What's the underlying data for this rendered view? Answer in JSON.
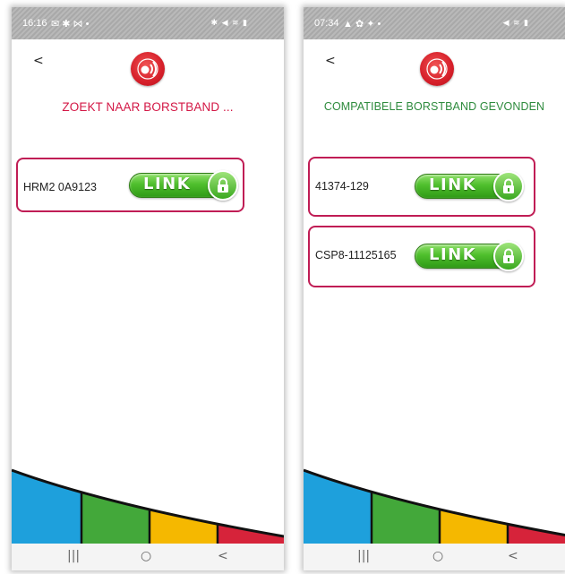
{
  "left_screen": {
    "status_time": "16:16",
    "status_left_icons": "✉ ✱ ⋈ •",
    "status_right_icons": "✱ ◀ ≋ ▮",
    "back_label": "<",
    "title": "ZOEKT NAAR BORSTBAND ...",
    "devices": [
      {
        "name": "HRM2 0A9123",
        "button_label": "LINK"
      }
    ],
    "nav": {
      "recents": "|||",
      "home": "○",
      "back": "<"
    }
  },
  "right_screen": {
    "status_time": "07:34",
    "status_left_icons": "▲ ✿ ✦ •",
    "status_right_icons": "◀ ≋ ▮",
    "back_label": "<",
    "title": "COMPATIBELE BORSTBAND GEVONDEN",
    "devices": [
      {
        "name": "41374-129",
        "button_label": "LINK"
      },
      {
        "name": "CSP8-11125165",
        "button_label": "LINK"
      }
    ],
    "nav": {
      "recents": "|||",
      "home": "○",
      "back": "<"
    }
  },
  "colors": {
    "title_searching": "#d31745",
    "title_found": "#2e8b3d",
    "card_border": "#c01d55",
    "link_green": "#4fbf2d",
    "wave_blue": "#1ea0dc",
    "wave_green": "#43a83a",
    "wave_yellow": "#f5b800",
    "wave_red": "#d6233a"
  },
  "icons": [
    "back-arrow-icon",
    "heart-signal-logo-icon",
    "lock-icon",
    "recents-icon",
    "home-icon",
    "nav-back-icon"
  ]
}
